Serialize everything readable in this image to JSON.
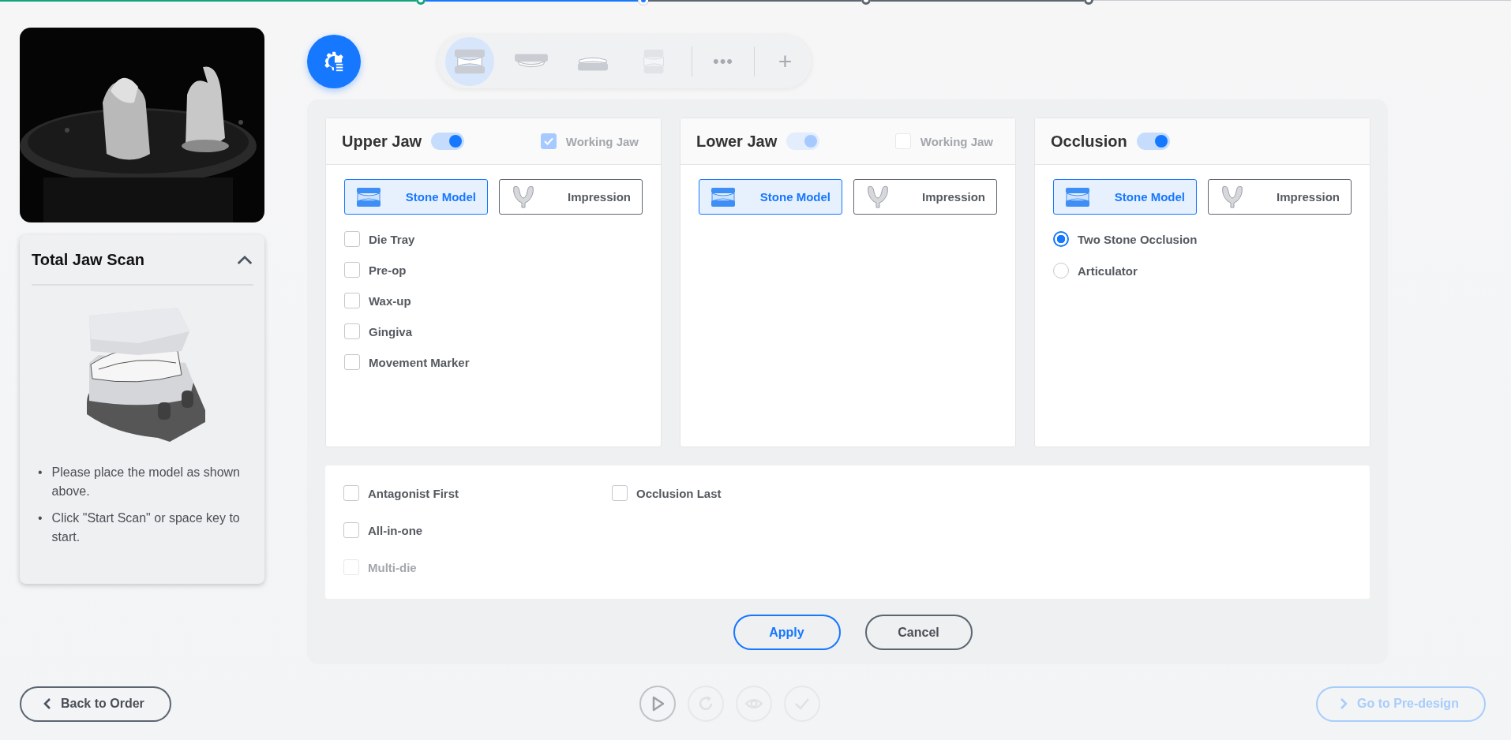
{
  "progress_steps": [
    {
      "done": true,
      "current": false
    },
    {
      "done": false,
      "current": true
    },
    {
      "done": false,
      "current": false
    },
    {
      "done": false,
      "current": false
    }
  ],
  "scan_info": {
    "title": "Total Jaw Scan",
    "expanded": true,
    "bullet": "•",
    "instructions": [
      "Please place the model as shown above.",
      "Click \"Start Scan\" or space key to start."
    ]
  },
  "toolbar": {
    "items": [
      {
        "kind": "full-jaw",
        "selected": true,
        "disabled": false
      },
      {
        "kind": "upper-jaw",
        "selected": false,
        "disabled": false
      },
      {
        "kind": "lower-jaw",
        "selected": false,
        "disabled": false
      },
      {
        "kind": "split-jaw",
        "selected": false,
        "disabled": true
      }
    ],
    "more": "•••",
    "add": "+"
  },
  "jaws": [
    {
      "title": "Upper Jaw",
      "on": true,
      "disabled": false,
      "working_jaw": {
        "label": "Working Jaw",
        "checked": true,
        "disabled": true
      },
      "types": [
        {
          "label": "Stone Model",
          "kind": "stone",
          "selected": true
        },
        {
          "label": "Impression",
          "kind": "impression",
          "selected": false
        }
      ],
      "kind": "checkboxes",
      "options": [
        {
          "label": "Die Tray",
          "checked": false
        },
        {
          "label": "Pre-op",
          "checked": false
        },
        {
          "label": "Wax-up",
          "checked": false
        },
        {
          "label": "Gingiva",
          "checked": false
        },
        {
          "label": "Movement Marker",
          "checked": false
        }
      ]
    },
    {
      "title": "Lower Jaw",
      "on": true,
      "disabled": true,
      "working_jaw": {
        "label": "Working Jaw",
        "checked": false,
        "disabled": true
      },
      "types": [
        {
          "label": "Stone Model",
          "kind": "stone",
          "selected": true
        },
        {
          "label": "Impression",
          "kind": "impression",
          "selected": false
        }
      ]
    },
    {
      "title": "Occlusion",
      "on": true,
      "disabled": false,
      "types": [
        {
          "label": "Stone Model",
          "kind": "stone",
          "selected": true
        },
        {
          "label": "Impression",
          "kind": "impression",
          "selected": false
        }
      ],
      "kind": "radios",
      "options": [
        {
          "label": "Two Stone Occlusion",
          "selected": true
        },
        {
          "label": "Articulator",
          "selected": false
        }
      ]
    }
  ],
  "scan_options": {
    "columns": [
      [
        {
          "label": "Antagonist First",
          "checked": false,
          "disabled": false
        },
        {
          "label": "All-in-one",
          "checked": false,
          "disabled": false
        },
        {
          "label": "Multi-die",
          "checked": false,
          "disabled": true
        }
      ],
      [
        {
          "label": "Occlusion Last",
          "checked": false,
          "disabled": false
        }
      ]
    ]
  },
  "actions": [
    {
      "label": "Apply",
      "kind": "primary"
    },
    {
      "label": "Cancel",
      "kind": "secondary"
    }
  ],
  "scan_controls": [
    {
      "kind": "play",
      "disabled": false
    },
    {
      "kind": "rescan",
      "disabled": true
    },
    {
      "kind": "preview",
      "disabled": true
    },
    {
      "kind": "confirm",
      "disabled": true
    }
  ],
  "back_button": {
    "label": "Back to Order"
  },
  "next_button": {
    "label": "Go to Pre-design",
    "disabled": true
  }
}
